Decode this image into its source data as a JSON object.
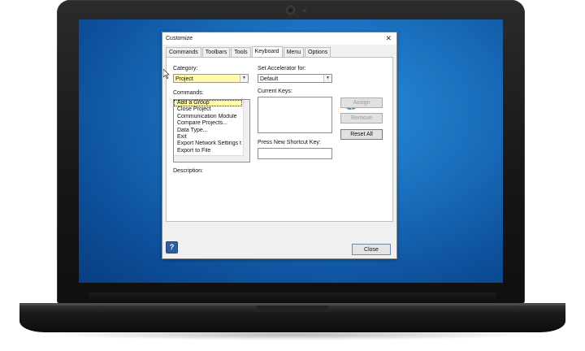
{
  "dialog": {
    "title": "Customize",
    "tabs": [
      "Commands",
      "Toolbars",
      "Tools",
      "Keyboard",
      "Menu",
      "Options"
    ],
    "active_tab": "Keyboard",
    "category_label": "Category:",
    "category_value": "Project",
    "commands_label": "Commands:",
    "commands": [
      "Add a Group",
      "Close Project",
      "Communication Module",
      "Compare Projects...",
      "Data Type...",
      "Exit",
      "Export Network Settings t",
      "Export to File"
    ],
    "selected_command": "Add a Group",
    "set_accelerator_label": "Set Accelerator for:",
    "set_accelerator_value": "Default",
    "current_keys_label": "Current Keys:",
    "press_new_label": "Press New Shortcut Key:",
    "description_label": "Description:",
    "buttons": {
      "assign": "Assign",
      "remove": "Remove",
      "reset_all": "Reset All",
      "close": "Close",
      "help": "?"
    },
    "colors": {
      "selection_yellow": "#fff9b2",
      "desktop_blue": "#1a6fbd"
    }
  }
}
